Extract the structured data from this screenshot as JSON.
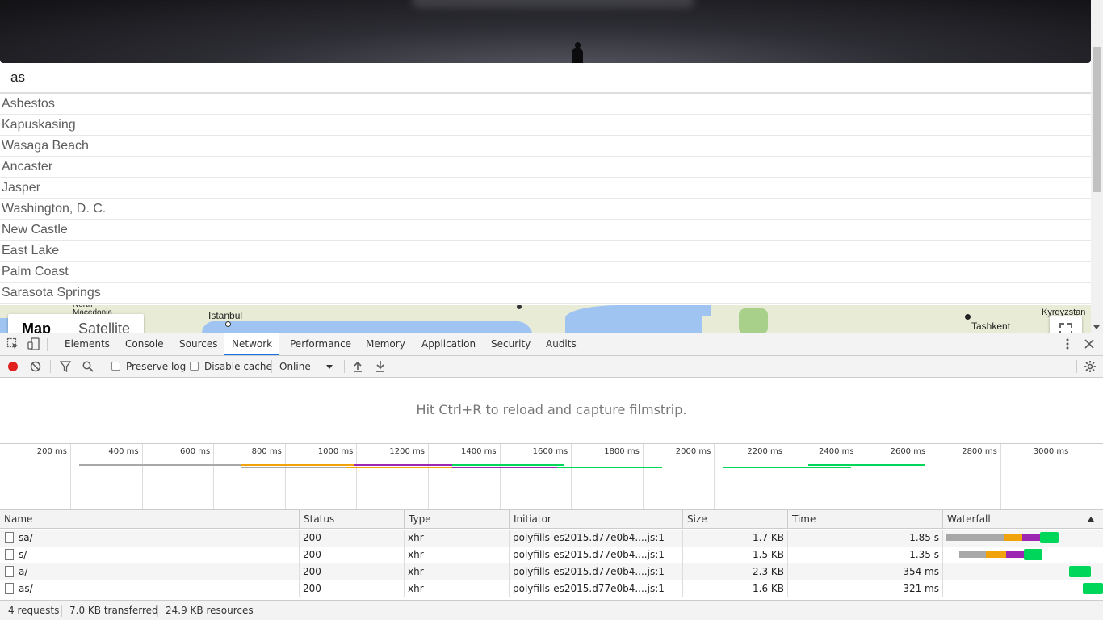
{
  "search": {
    "value": "as"
  },
  "suggestions": [
    "Asbestos",
    "Kapuskasing",
    "Wasaga Beach",
    "Ancaster",
    "Jasper",
    "Washington, D. C.",
    "New Castle",
    "East Lake",
    "Palm Coast",
    "Sarasota Springs"
  ],
  "map": {
    "labels": {
      "north_macedonia": "North\nMacedonia",
      "istanbul": "Istanbul",
      "tashkent": "Tashkent",
      "kyrgyzstan": "Kyrgyzstan"
    },
    "type_controls": {
      "map": "Map",
      "satellite": "Satellite"
    },
    "land_color": "#e8ecd6",
    "water_color": "#9fc4f2"
  },
  "devtools": {
    "tabs": [
      "Elements",
      "Console",
      "Sources",
      "Network",
      "Performance",
      "Memory",
      "Application",
      "Security",
      "Audits"
    ],
    "active_tab": "Network",
    "accent_color": "#1a73e8",
    "toolbar": {
      "preserve_log": "Preserve log",
      "disable_cache": "Disable cache",
      "throttling": "Online",
      "record_active": true
    },
    "filmstrip_message": "Hit Ctrl+R to reload and capture filmstrip.",
    "overview_ticks": [
      "200 ms",
      "400 ms",
      "600 ms",
      "800 ms",
      "1000 ms",
      "1200 ms",
      "1400 ms",
      "1600 ms",
      "1800 ms",
      "2000 ms",
      "2200 ms",
      "2400 ms",
      "2600 ms",
      "2800 ms",
      "3000 ms"
    ],
    "columns": {
      "name": "Name",
      "status": "Status",
      "type": "Type",
      "initiator": "Initiator",
      "size": "Size",
      "time": "Time",
      "waterfall": "Waterfall"
    },
    "requests": [
      {
        "name": "sa/",
        "status": "200",
        "type": "xhr",
        "initiator": "polyfills-es2015.d77e0b4....js:1",
        "size": "1.7 KB",
        "time": "1.85 s"
      },
      {
        "name": "s/",
        "status": "200",
        "type": "xhr",
        "initiator": "polyfills-es2015.d77e0b4....js:1",
        "size": "1.5 KB",
        "time": "1.35 s"
      },
      {
        "name": "a/",
        "status": "200",
        "type": "xhr",
        "initiator": "polyfills-es2015.d77e0b4....js:1",
        "size": "2.3 KB",
        "time": "354 ms"
      },
      {
        "name": "as/",
        "status": "200",
        "type": "xhr",
        "initiator": "polyfills-es2015.d77e0b4....js:1",
        "size": "1.6 KB",
        "time": "321 ms"
      }
    ],
    "status": {
      "requests": "4 requests",
      "transferred": "7.0 KB transferred",
      "resources": "24.9 KB resources"
    },
    "timing_colors": {
      "queue": "#a8a8a8",
      "stalled": "#f0a30a",
      "waiting": "#9c27b0",
      "receiving": "#00d65a"
    }
  }
}
